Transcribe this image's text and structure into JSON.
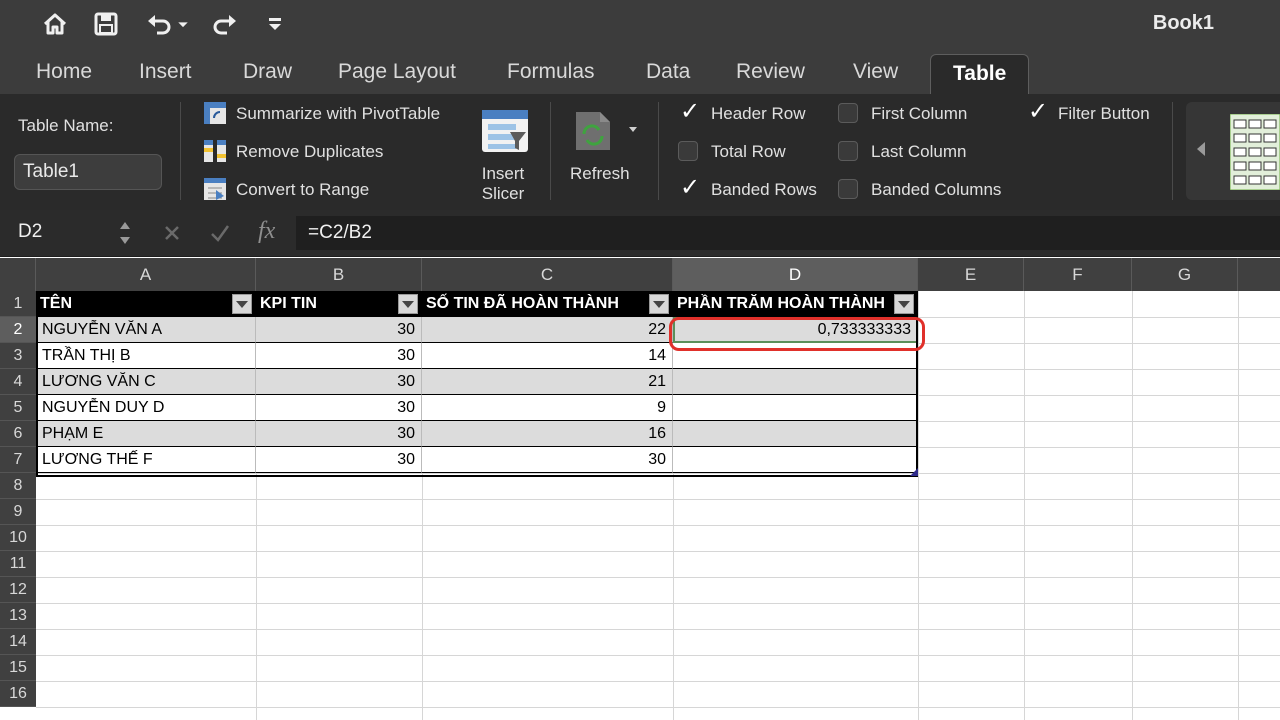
{
  "window": {
    "title": "Book1"
  },
  "ribbon_tabs": [
    "Home",
    "Insert",
    "Draw",
    "Page Layout",
    "Formulas",
    "Data",
    "Review",
    "View",
    "Table"
  ],
  "ribbon": {
    "table_name_label": "Table Name:",
    "table_name_value": "Table1",
    "tools": {
      "summarize": "Summarize with PivotTable",
      "remove_duplicates": "Remove Duplicates",
      "convert_to_range": "Convert to Range"
    },
    "insert_slicer": [
      "Insert",
      "Slicer"
    ],
    "refresh": "Refresh",
    "options": {
      "header_row": "Header Row",
      "total_row": "Total Row",
      "banded_rows": "Banded Rows",
      "first_column": "First Column",
      "last_column": "Last Column",
      "banded_columns": "Banded Columns",
      "filter_button": "Filter Button"
    }
  },
  "formula_bar": {
    "name_box": "D2",
    "fx": "fx",
    "formula": "=C2/B2"
  },
  "grid": {
    "columns": [
      "A",
      "B",
      "C",
      "D",
      "E",
      "F",
      "G"
    ],
    "rows": [
      "1",
      "2",
      "3",
      "4",
      "5",
      "6",
      "7",
      "8",
      "9",
      "10",
      "11",
      "12",
      "13",
      "14",
      "15",
      "16"
    ],
    "headers": [
      "TÊN",
      "KPI TIN",
      "SỐ TIN ĐÃ HOÀN THÀNH",
      "PHẦN TRĂM HOÀN THÀNH"
    ],
    "data": [
      [
        "NGUYỄN VĂN A",
        "30",
        "22",
        "0,733333333"
      ],
      [
        "TRẦN THỊ B",
        "30",
        "14",
        ""
      ],
      [
        "LƯƠNG VĂN C",
        "30",
        "21",
        ""
      ],
      [
        "NGUYỄN DUY D",
        "30",
        "9",
        ""
      ],
      [
        "PHẠM E",
        "30",
        "16",
        ""
      ],
      [
        "LƯƠNG THẾ F",
        "30",
        "30",
        ""
      ]
    ],
    "selected_cell": "D2"
  },
  "colors": {
    "band": "#dcdcdc",
    "header_bg": "#000000",
    "highlight": "#e0302a",
    "chrome": "#3c3c3c"
  }
}
